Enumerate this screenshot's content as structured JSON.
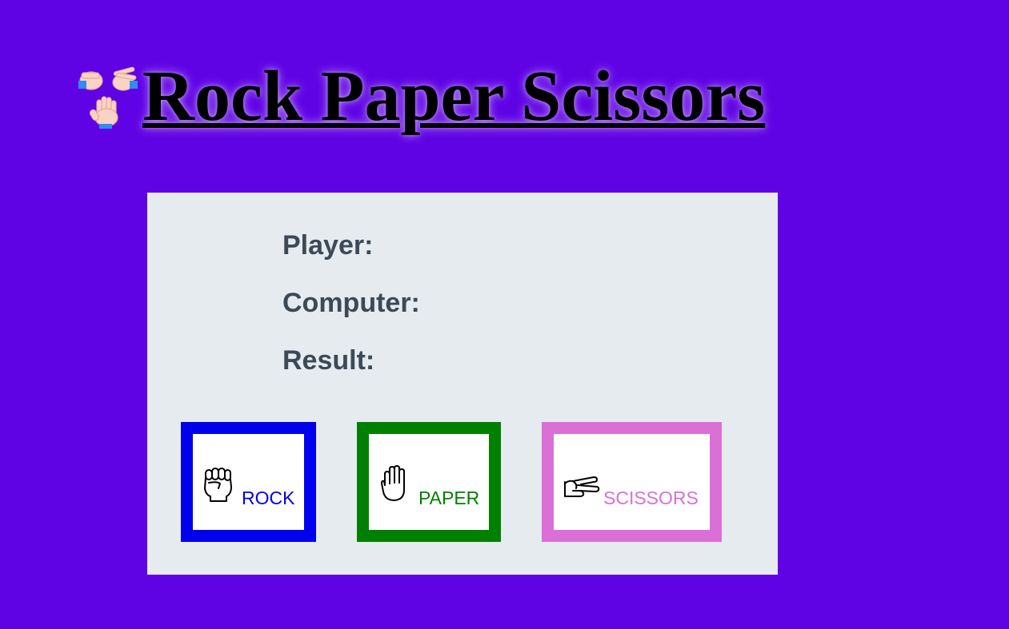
{
  "header": {
    "title": "Rock Paper Scissors",
    "title_icon": "rock-paper-scissors-hands-icon"
  },
  "scoreboard": {
    "player_label": "Player:",
    "player_value": "",
    "computer_label": "Computer:",
    "computer_value": "",
    "result_label": "Result:",
    "result_value": ""
  },
  "choices": [
    {
      "label": "ROCK",
      "icon": "fist-icon",
      "color": "#0000ee"
    },
    {
      "label": "PAPER",
      "icon": "open-hand-icon",
      "color": "#008000"
    },
    {
      "label": "SCISSORS",
      "icon": "victory-hand-icon",
      "color": "#da70d6"
    }
  ],
  "colors": {
    "page_background": "#5f03e5",
    "panel_background": "#e6ebf0",
    "info_text": "#3c4a57"
  }
}
